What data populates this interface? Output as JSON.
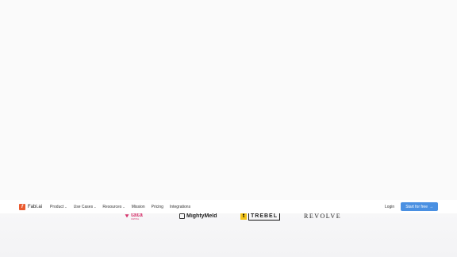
{
  "nav": {
    "brand": {
      "mark": "f",
      "name": "Fabi.ai",
      "brand_color": "#ea5a2f"
    },
    "items": [
      {
        "label": "Product",
        "has_dropdown": true
      },
      {
        "label": "Use Cases",
        "has_dropdown": true
      },
      {
        "label": "Resources",
        "has_dropdown": true
      },
      {
        "label": "Mission",
        "has_dropdown": false
      },
      {
        "label": "Pricing",
        "has_dropdown": false
      },
      {
        "label": "Integrations",
        "has_dropdown": false
      }
    ],
    "login_label": "Login",
    "cta_label": "Start for free",
    "cta_arrow": "→",
    "cta_color": "#4a90e2"
  },
  "customer_logos": {
    "tata": {
      "name": "tata",
      "sub": "CAPITAL"
    },
    "mightymeld": {
      "name": "MightyMeld"
    },
    "trebel": {
      "mark": "t",
      "name": "TREBEL"
    },
    "revolve": {
      "name": "REVOLVE"
    }
  },
  "icons": {
    "dropdown": "chevron-down-icon",
    "cta": "arrow-right-icon"
  }
}
